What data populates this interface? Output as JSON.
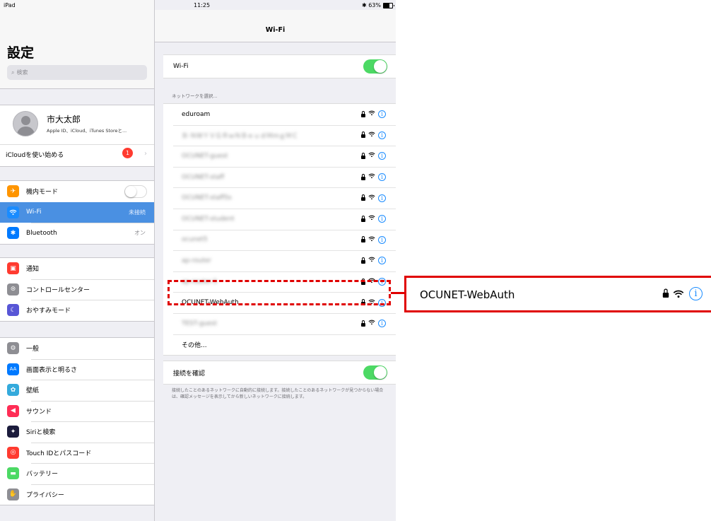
{
  "status_bar": {
    "device": "iPad",
    "time": "11:25",
    "bluetooth_battery": "✱ 63%"
  },
  "sidebar": {
    "title": "設定",
    "search_placeholder": "検索",
    "profile": {
      "name": "市大太郎",
      "subtitle": "Apple ID、iCloud、iTunes Storeと..."
    },
    "icloud": {
      "label": "iCloudを使い始める",
      "badge": "1"
    },
    "group1": [
      {
        "label": "機内モード",
        "icon": "airplane-icon",
        "color": "#ff9500"
      },
      {
        "label": "Wi-Fi",
        "value": "未接続",
        "icon": "wifi-icon",
        "color": "#1a8cff"
      },
      {
        "label": "Bluetooth",
        "value": "オン",
        "icon": "bluetooth-icon",
        "color": "#007aff"
      }
    ],
    "group2": [
      {
        "label": "通知",
        "icon": "notifications-icon",
        "color": "#ff3b30"
      },
      {
        "label": "コントロールセンター",
        "icon": "control-center-icon",
        "color": "#8e8e93"
      },
      {
        "label": "おやすみモード",
        "icon": "moon-icon",
        "color": "#5856d6"
      }
    ],
    "group3": [
      {
        "label": "一般",
        "icon": "gear-icon",
        "color": "#8e8e93"
      },
      {
        "label": "画面表示と明るさ",
        "icon": "display-icon",
        "color": "#007aff",
        "glyph": "AA"
      },
      {
        "label": "壁紙",
        "icon": "wallpaper-icon",
        "color": "#34aadc"
      },
      {
        "label": "サウンド",
        "icon": "speaker-icon",
        "color": "#ff2d55"
      },
      {
        "label": "Siriと検索",
        "icon": "siri-icon",
        "color": "#1c1c3c"
      },
      {
        "label": "Touch IDとパスコード",
        "icon": "fingerprint-icon",
        "color": "#ff3b30"
      },
      {
        "label": "バッテリー",
        "icon": "battery-icon",
        "color": "#4cd964"
      },
      {
        "label": "プライバシー",
        "icon": "hand-icon",
        "color": "#8e8e93"
      }
    ]
  },
  "wifi_page": {
    "nav_title": "Wi-Fi",
    "wifi_label": "Wi-Fi",
    "choose_network_label": "ネットワークを選択...",
    "networks": [
      {
        "ssid": "eduroam",
        "blurred": false
      },
      {
        "ssid": "Ｂ·ＮＷＹＶＧＲｗＮＢｅｕｄＭｍｇＭＣ",
        "blurred": true
      },
      {
        "ssid": "OCUNET-guest",
        "blurred": true
      },
      {
        "ssid": "OCUNET-staff",
        "blurred": true
      },
      {
        "ssid": "OCUNET-staff5s",
        "blurred": true
      },
      {
        "ssid": "OCUNET-student",
        "blurred": true
      },
      {
        "ssid": "ocunet5",
        "blurred": true
      },
      {
        "ssid": "ap-router",
        "blurred": true
      },
      {
        "ssid": "ap-router-5",
        "blurred": true
      },
      {
        "ssid": "OCUNET-WebAuth",
        "blurred": false
      },
      {
        "ssid": "TEST-guest",
        "blurred": true
      }
    ],
    "other_label": "その他...",
    "ask_to_join_label": "接続を確認",
    "ask_to_join_description": "接続したことのあるネットワークに自動的に接続します。接続したことのあるネットワークが見つからない場合は、確認メッセージを表示してから新しいネットワークに接続します。"
  },
  "callout": {
    "ssid": "OCUNET-WebAuth",
    "highlight_color": "#e00000"
  }
}
